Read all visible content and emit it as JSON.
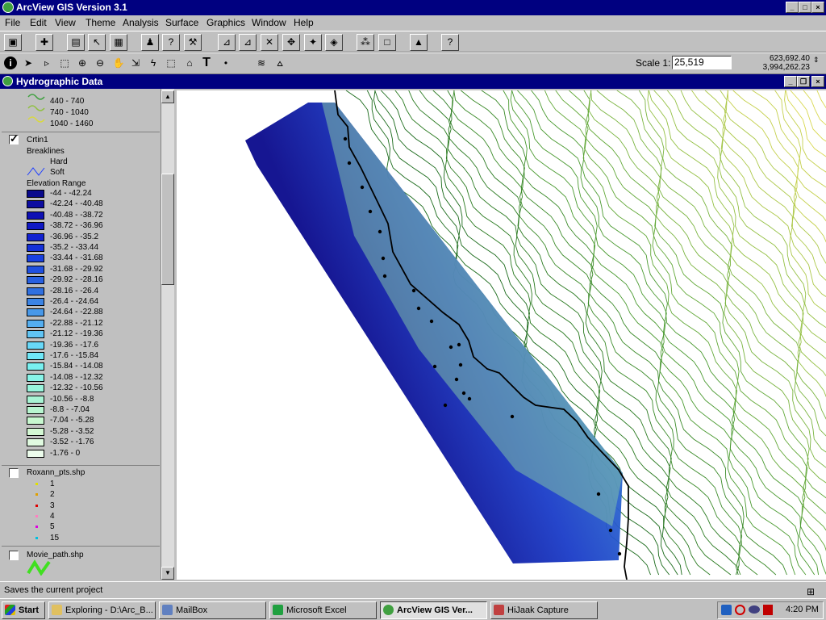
{
  "app": {
    "title": "ArcView GIS Version 3.1",
    "win_buttons": [
      "_",
      "□",
      "×"
    ]
  },
  "menu": [
    "File",
    "Edit",
    "View",
    "Theme",
    "Analysis",
    "Surface",
    "Graphics",
    "Window",
    "Help"
  ],
  "scale": {
    "label": "Scale 1:",
    "value": "25,519",
    "coord_x": "623,692.40",
    "coord_y": "3,994,262.23"
  },
  "view_window": {
    "title": "Hydrographic Data"
  },
  "toc": {
    "contour_ranges": [
      "440 - 740",
      "740 - 1040",
      "1040 - 1460"
    ],
    "contour_colors": [
      "#40a040",
      "#90c040",
      "#d8d840"
    ],
    "crtin": {
      "name": "Crtin1",
      "breaklines_label": "Breaklines",
      "hard_label": "Hard",
      "soft_label": "Soft",
      "elevation_label": "Elevation Range",
      "ranges": [
        "-44 - -42.24",
        "-42.24 - -40.48",
        "-40.48 - -38.72",
        "-38.72 - -36.96",
        "-36.96 - -35.2",
        "-35.2 - -33.44",
        "-33.44 - -31.68",
        "-31.68 - -29.92",
        "-29.92 - -28.16",
        "-28.16 - -26.4",
        "-26.4 - -24.64",
        "-24.64 - -22.88",
        "-22.88 - -21.12",
        "-21.12 - -19.36",
        "-19.36 - -17.6",
        "-17.6 - -15.84",
        "-15.84 - -14.08",
        "-14.08 - -12.32",
        "-12.32 - -10.56",
        "-10.56 - -8.8",
        "-8.8 - -7.04",
        "-7.04 - -5.28",
        "-5.28 - -3.52",
        "-3.52 - -1.76",
        "-1.76 - 0"
      ],
      "colors": [
        "#0a0a8c",
        "#0c0ca0",
        "#0e10b4",
        "#1018c4",
        "#1222d0",
        "#1430d8",
        "#1840e0",
        "#2050e0",
        "#2860e0",
        "#3070e0",
        "#3c84e4",
        "#4898e8",
        "#54aef0",
        "#60c4f4",
        "#68d8f8",
        "#70e8f8",
        "#78f0f0",
        "#88f4e8",
        "#98f4dc",
        "#a8f4d4",
        "#b8f6d0",
        "#c8f8d0",
        "#d4f8d4",
        "#e0fae0",
        "#ecfcec"
      ]
    },
    "roxann": {
      "name": "Roxann_pts.shp",
      "values": [
        "1",
        "2",
        "3",
        "4",
        "5",
        "15"
      ],
      "colors": [
        "#e0e000",
        "#e0a000",
        "#e00000",
        "#ff80c0",
        "#e000e0",
        "#00c0e0"
      ]
    },
    "movie": {
      "name": "Movie_path.shp"
    }
  },
  "status_text": "Saves the current project",
  "taskbar": {
    "start": "Start",
    "tasks": [
      "Exploring - D:\\Arc_B...",
      "MailBox",
      "Microsoft Excel",
      "ArcView GIS Ver...",
      "HiJaak Capture"
    ],
    "clock": "4:20 PM"
  }
}
